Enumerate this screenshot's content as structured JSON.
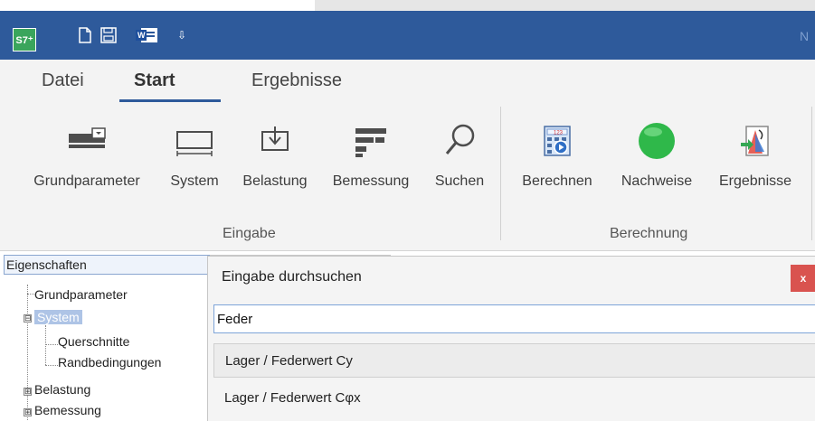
{
  "titlebar": {
    "app_icon_text": "S7⁺",
    "title_fragment": "N",
    "quick_access": [
      "new-document-icon",
      "save-icon",
      "word-icon",
      "customize-dropdown-icon"
    ],
    "dropdown_glyph": "⇩"
  },
  "ribbon": {
    "tabs": [
      {
        "label": "Datei",
        "active": false
      },
      {
        "label": "Start",
        "active": true
      },
      {
        "label": "Ergebnisse",
        "active": false
      }
    ],
    "groups": [
      {
        "label": "Eingabe",
        "buttons": [
          {
            "label": "Grundparameter",
            "icon": "grundparameter-icon"
          },
          {
            "label": "System",
            "icon": "system-icon"
          },
          {
            "label": "Belastung",
            "icon": "belastung-icon"
          },
          {
            "label": "Bemessung",
            "icon": "bemessung-icon"
          },
          {
            "label": "Suchen",
            "icon": "search-icon"
          }
        ]
      },
      {
        "label": "Berechnung",
        "buttons": [
          {
            "label": "Berechnen",
            "icon": "calculator-icon"
          },
          {
            "label": "Nachweise",
            "icon": "green-circle-icon"
          },
          {
            "label": "Ergebnisse",
            "icon": "results-icon"
          }
        ]
      }
    ],
    "accent": "#2e5a9b"
  },
  "properties": {
    "header": "Eigenschaften",
    "tree": [
      {
        "label": "Grundparameter",
        "level": 1
      },
      {
        "label": "System",
        "level": 1,
        "selected": true,
        "expander": "⊟"
      },
      {
        "label": "Querschnitte",
        "level": 2
      },
      {
        "label": "Randbedingungen",
        "level": 2
      },
      {
        "label": "Belastung",
        "level": 1,
        "expander": "⊞"
      },
      {
        "label": "Bemessung",
        "level": 1,
        "expander": "⊞"
      }
    ]
  },
  "search": {
    "title": "Eingabe durchsuchen",
    "close_label": "x",
    "value": "Feder",
    "results": [
      "Lager / Federwert Cy",
      "Lager / Federwert Cφx"
    ]
  }
}
